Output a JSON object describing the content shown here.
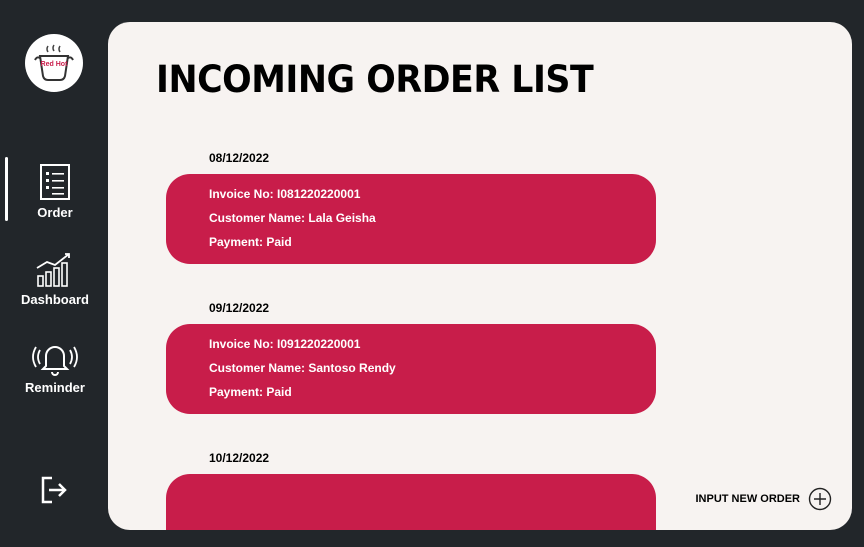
{
  "sidebar": {
    "logo_text": "Red Hot",
    "items": [
      {
        "label": "Order",
        "icon": "order-list-icon",
        "active": true
      },
      {
        "label": "Dashboard",
        "icon": "bar-chart-icon",
        "active": false
      },
      {
        "label": "Reminder",
        "icon": "bell-ringing-icon",
        "active": false
      }
    ],
    "logout_icon": "logout-icon"
  },
  "main": {
    "title": "INCOMING ORDER LIST",
    "orders": [
      {
        "date": "08/12/2022",
        "invoice": "Invoice No: I081220220001",
        "customer": "Customer Name: Lala Geisha",
        "payment": "Payment: Paid"
      },
      {
        "date": "09/12/2022",
        "invoice": "Invoice No: I091220220001",
        "customer": "Customer Name: Santoso Rendy",
        "payment": "Payment: Paid"
      },
      {
        "date": "10/12/2022"
      }
    ],
    "input_new_order": "INPUT NEW ORDER"
  },
  "colors": {
    "card": "#c81d4a",
    "sidebar": "#22262a",
    "panel": "#f7f3f1"
  }
}
